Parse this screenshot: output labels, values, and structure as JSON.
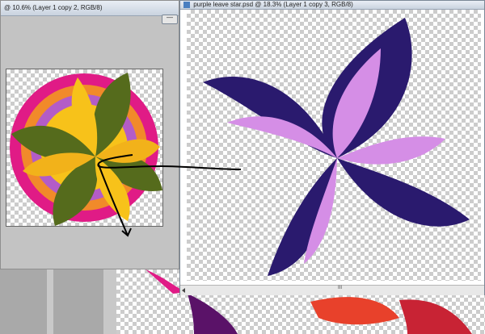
{
  "left_window": {
    "title": "@ 10.6% (Layer 1 copy 2, RGB/8)"
  },
  "right_window": {
    "title": "purple leave star.psd @ 18.3% (Layer 1 copy 3, RGB/8)",
    "minimize_glyph": "—",
    "scroll_thumb_glyph": "III"
  },
  "colors": {
    "leaf_purple_dark": "#2a1a6e",
    "leaf_pink": "#d58ee6",
    "leaf_olive": "#556b1c",
    "leaf_yellow": "#f7c21a",
    "magenta": "#e01b86",
    "red": "#e8412b"
  },
  "icons": [
    "document-icon",
    "minimize-icon",
    "scroll-left-arrow-icon",
    "scroll-thumb-icon"
  ]
}
